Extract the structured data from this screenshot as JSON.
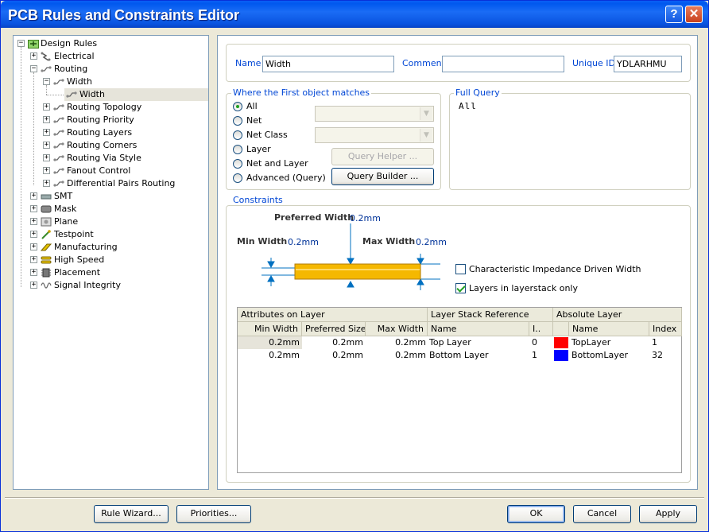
{
  "window": {
    "title": "PCB Rules and Constraints Editor",
    "help_glyph": "?",
    "close_glyph": "✕"
  },
  "tree": {
    "root": "Design Rules",
    "items": {
      "electrical": "Electrical",
      "routing": "Routing",
      "width_group": "Width",
      "width_rule": "Width",
      "routing_topology": "Routing Topology",
      "routing_priority": "Routing Priority",
      "routing_layers": "Routing Layers",
      "routing_corners": "Routing Corners",
      "routing_via_style": "Routing Via Style",
      "fanout_control": "Fanout Control",
      "diff_pairs": "Differential Pairs Routing",
      "smt": "SMT",
      "mask": "Mask",
      "plane": "Plane",
      "testpoint": "Testpoint",
      "manufacturing": "Manufacturing",
      "high_speed": "High Speed",
      "placement": "Placement",
      "signal_integrity": "Signal Integrity"
    }
  },
  "header": {
    "name_label": "Name",
    "name_value": "Width",
    "comment_label": "Comment",
    "comment_value": "",
    "uid_label": "Unique ID",
    "uid_value": "YDLARHMU"
  },
  "match": {
    "title": "Where the First object matches",
    "options": {
      "all": "All",
      "net": "Net",
      "net_class": "Net Class",
      "layer": "Layer",
      "net_and_layer": "Net and Layer",
      "advanced": "Advanced (Query)"
    },
    "selected": "All",
    "query_helper": "Query Helper ...",
    "query_builder": "Query Builder ..."
  },
  "full_query": {
    "title": "Full Query",
    "text": "All"
  },
  "constraints": {
    "title": "Constraints",
    "preferred_label": "Preferred Width",
    "preferred_value": "0.2mm",
    "min_label": "Min Width",
    "min_value": "0.2mm",
    "max_label": "Max Width",
    "max_value": "0.2mm",
    "impedance_label": "Characteristic Impedance Driven Width",
    "impedance_checked": false,
    "layerstack_label": "Layers in layerstack only",
    "layerstack_checked": true,
    "trace_color": "#F5B800"
  },
  "grid": {
    "group_headers": {
      "attributes": "Attributes on Layer",
      "stack": "Layer Stack Reference",
      "absolute": "Absolute Layer"
    },
    "columns": {
      "min": "Min Width",
      "pref": "Preferred Size",
      "max": "Max Width",
      "name": "Name",
      "idx": "I..",
      "abs_name": "Name",
      "abs_index": "Index"
    },
    "rows": [
      {
        "min": "0.2mm",
        "pref": "0.2mm",
        "max": "0.2mm",
        "name": "Top Layer",
        "idx": "0",
        "color": "#FF0000",
        "abs_name": "TopLayer",
        "abs_index": "1"
      },
      {
        "min": "0.2mm",
        "pref": "0.2mm",
        "max": "0.2mm",
        "name": "Bottom Layer",
        "idx": "1",
        "color": "#0000FF",
        "abs_name": "BottomLayer",
        "abs_index": "32"
      }
    ]
  },
  "buttons": {
    "rule_wizard": "Rule Wizard...",
    "priorities": "Priorities...",
    "ok": "OK",
    "cancel": "Cancel",
    "apply": "Apply"
  }
}
